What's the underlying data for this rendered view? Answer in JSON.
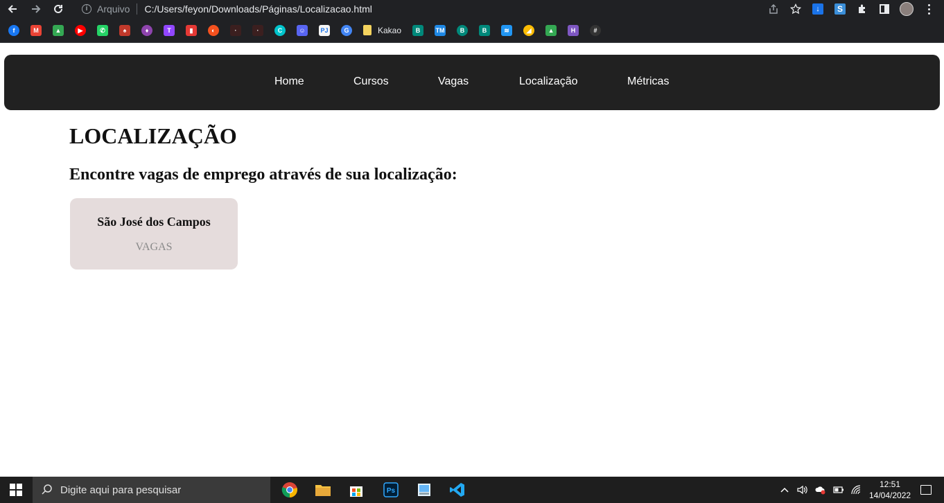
{
  "browser": {
    "scheme_label": "Arquivo",
    "url": "C:/Users/feyon/Downloads/Páginas/Localizacao.html",
    "bookmarks": [
      {
        "icon": "facebook-icon",
        "color": "#1877f2",
        "glyph": "f"
      },
      {
        "icon": "gmail-icon",
        "color": "#ea4335",
        "glyph": "M"
      },
      {
        "icon": "google-drive-icon",
        "color": "#34a853",
        "glyph": "▲"
      },
      {
        "icon": "youtube-music-icon",
        "color": "#ff0000",
        "glyph": "▶"
      },
      {
        "icon": "whatsapp-icon",
        "color": "#25d366",
        "glyph": "✆"
      },
      {
        "icon": "mascot-icon",
        "color": "#c0392b",
        "glyph": "♠"
      },
      {
        "icon": "game-icon",
        "color": "#8e44ad",
        "glyph": "♦"
      },
      {
        "icon": "twitch-icon",
        "color": "#9146ff",
        "glyph": "T"
      },
      {
        "icon": "red-book-icon",
        "color": "#e53935",
        "glyph": "▮"
      },
      {
        "icon": "orange-circle-icon",
        "color": "#f4511e",
        "glyph": "◐"
      },
      {
        "icon": "dark-site-icon",
        "color": "#3b1f1f",
        "glyph": "·"
      },
      {
        "icon": "dark-site-icon-2",
        "color": "#3b1f1f",
        "glyph": "·"
      },
      {
        "icon": "canva-icon",
        "color": "#00c4cc",
        "glyph": "C"
      },
      {
        "icon": "discord-icon",
        "color": "#5865f2",
        "glyph": "☺"
      },
      {
        "icon": "pj-icon",
        "color": "#f5f5f5",
        "glyph": "PJ"
      },
      {
        "icon": "google-translate-icon",
        "color": "#4285f4",
        "glyph": "G"
      }
    ],
    "kakao_label": "Kakao",
    "bookmarks_after": [
      {
        "icon": "b-teal-icon",
        "color": "#00897b",
        "glyph": "B"
      },
      {
        "icon": "tm-icon",
        "color": "#1e88e5",
        "glyph": "TM"
      },
      {
        "icon": "b-teal-icon-2",
        "color": "#00897b",
        "glyph": "B"
      },
      {
        "icon": "b-teal-icon-3",
        "color": "#00897b",
        "glyph": "B"
      },
      {
        "icon": "stack-icon",
        "color": "#2196f3",
        "glyph": "≋"
      },
      {
        "icon": "google-ads-icon",
        "color": "#fbbc04",
        "glyph": "◢"
      },
      {
        "icon": "google-drive-icon-2",
        "color": "#34a853",
        "glyph": "▲"
      },
      {
        "icon": "h-purple-icon",
        "color": "#7e57c2",
        "glyph": "H"
      },
      {
        "icon": "grid-icon",
        "color": "#333333",
        "glyph": "#"
      }
    ]
  },
  "nav": {
    "items": [
      "Home",
      "Cursos",
      "Vagas",
      "Localização",
      "Métricas"
    ]
  },
  "main": {
    "title": "LOCALIZAÇÃO",
    "subtitle": "Encontre vagas de emprego através de sua localização:",
    "cards": [
      {
        "title": "São José dos Campos",
        "subtitle": "VAGAS"
      }
    ]
  },
  "taskbar": {
    "search_placeholder": "Digite aqui para pesquisar",
    "time": "12:51",
    "date": "14/04/2022"
  }
}
